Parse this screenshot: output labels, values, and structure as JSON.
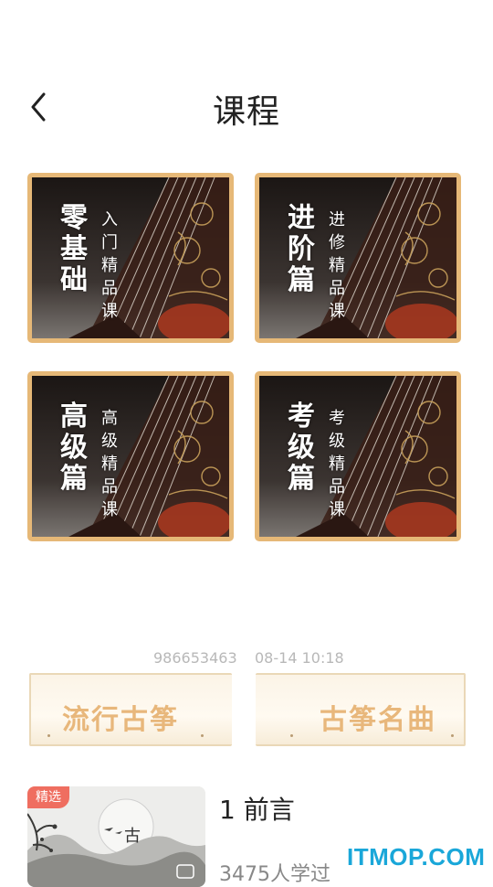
{
  "header": {
    "title": "课程",
    "back_icon": "chevron-left-icon"
  },
  "courses": [
    {
      "big": [
        "零",
        "基",
        "础"
      ],
      "small": [
        "入",
        "门",
        "精",
        "品",
        "课"
      ]
    },
    {
      "big": [
        "进",
        "阶",
        "篇"
      ],
      "small": [
        "进",
        "修",
        "精",
        "品",
        "课"
      ]
    },
    {
      "big": [
        "高",
        "级",
        "篇"
      ],
      "small": [
        "高",
        "级",
        "精",
        "品",
        "课"
      ]
    },
    {
      "big": [
        "考",
        "级",
        "篇"
      ],
      "small": [
        "考",
        "级",
        "精",
        "品",
        "课"
      ]
    }
  ],
  "meta": {
    "id": "986653463",
    "time": "08-14 10:18"
  },
  "categories": [
    {
      "label": "流行古筝"
    },
    {
      "label": "古筝名曲"
    }
  ],
  "lesson": {
    "badge": "精选",
    "title": "1 前言",
    "count": "3475人学过",
    "thumb_char": "古"
  },
  "watermark": "ITMOP.COM",
  "colors": {
    "card_border": "#e6b877",
    "banner_text": "#e8b77b",
    "badge": "#ef6e60",
    "watermark": "#1aa7d9"
  }
}
